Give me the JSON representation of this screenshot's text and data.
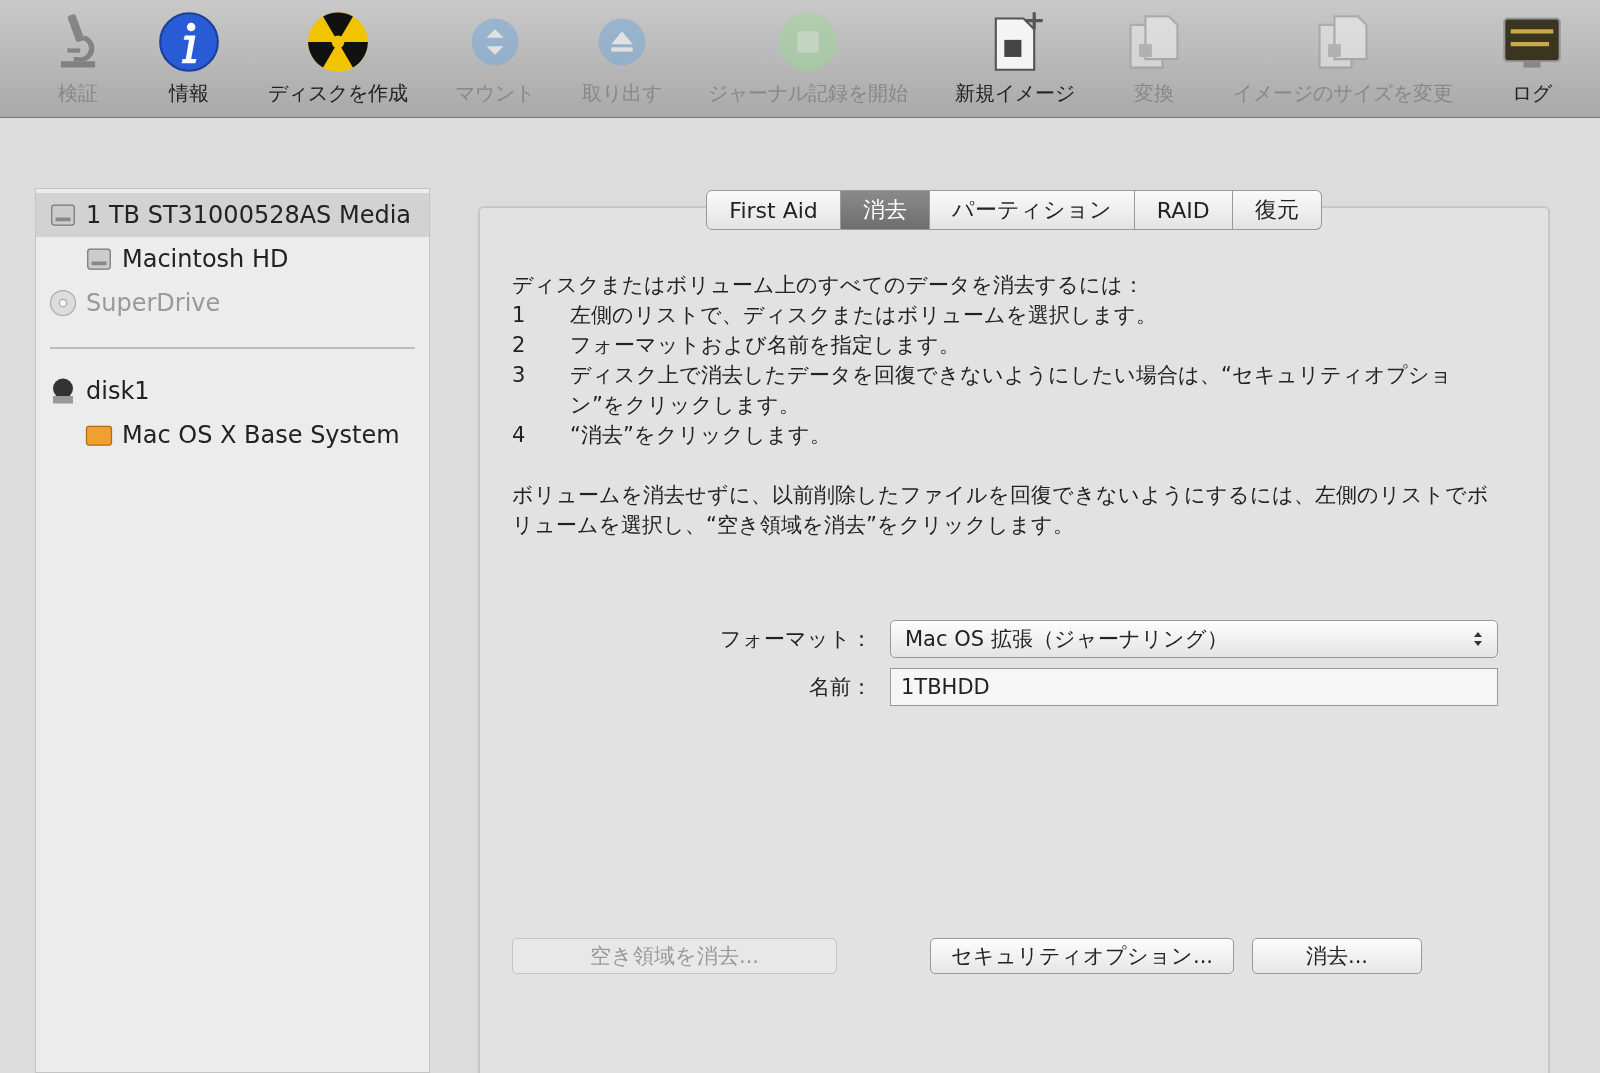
{
  "toolbar": [
    {
      "kind": "microscope",
      "label": "検証",
      "disabled": true
    },
    {
      "kind": "info",
      "label": "情報",
      "disabled": false
    },
    {
      "kind": "burn",
      "label": "ディスクを作成",
      "disabled": false
    },
    {
      "kind": "mount",
      "label": "マウント",
      "disabled": true
    },
    {
      "kind": "eject",
      "label": "取り出す",
      "disabled": true
    },
    {
      "kind": "journal",
      "label": "ジャーナル記録を開始",
      "disabled": true
    },
    {
      "kind": "newimage",
      "label": "新規イメージ",
      "disabled": false
    },
    {
      "kind": "convert",
      "label": "変換",
      "disabled": true
    },
    {
      "kind": "resize",
      "label": "イメージのサイズを変更",
      "disabled": true
    },
    {
      "kind": "log",
      "label": "ログ",
      "disabled": false
    }
  ],
  "sidebar": {
    "groups": [
      {
        "items": [
          {
            "kind": "hdd",
            "label": "1 TB ST31000528AS Media",
            "selected": true,
            "disabled": false,
            "children": [
              {
                "kind": "hdd",
                "label": "Macintosh HD",
                "selected": false,
                "disabled": false
              }
            ]
          },
          {
            "kind": "optical",
            "label": "SuperDrive",
            "selected": false,
            "disabled": true
          }
        ]
      },
      {
        "items": [
          {
            "kind": "image",
            "label": "disk1",
            "selected": false,
            "disabled": false,
            "children": [
              {
                "kind": "volume",
                "label": "Mac OS X Base System",
                "selected": false,
                "disabled": false
              }
            ]
          }
        ]
      }
    ]
  },
  "tabs": [
    {
      "label": "First Aid",
      "selected": false
    },
    {
      "label": "消去",
      "selected": true
    },
    {
      "label": "パーティション",
      "selected": false
    },
    {
      "label": "RAID",
      "selected": false
    },
    {
      "label": "復元",
      "selected": false
    }
  ],
  "instructions": {
    "heading": "ディスクまたはボリューム上のすべてのデータを消去するには：",
    "steps": [
      {
        "number": "1",
        "text": "左側のリストで、ディスクまたはボリュームを選択します。"
      },
      {
        "number": "2",
        "text": "フォーマットおよび名前を指定します。"
      },
      {
        "number": "3",
        "text": "ディスク上で消去したデータを回復できないようにしたい場合は、“セキュリティオプション”をクリックします。"
      },
      {
        "number": "4",
        "text": "“消去”をクリックします。"
      }
    ],
    "note": "ボリュームを消去せずに、以前削除したファイルを回復できないようにするには、左側のリストでボリュームを選択し、“空き領域を消去”をクリックします。"
  },
  "format": {
    "label": "フォーマット：",
    "value": "Mac OS 拡張（ジャーナリング）"
  },
  "name": {
    "label": "名前：",
    "value": "1TBHDD"
  },
  "buttons": [
    {
      "label": "空き領域を消去...",
      "disabled": true
    },
    {
      "label": "セキュリティオプション...",
      "disabled": false
    },
    {
      "label": "消去...",
      "disabled": false
    }
  ]
}
